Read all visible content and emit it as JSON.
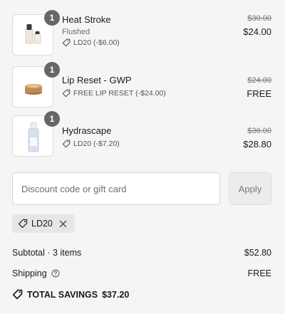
{
  "items": [
    {
      "quantity": "1",
      "name": "Heat Stroke",
      "variant": "Flushed",
      "discount": "LD20 (-$6.00)",
      "original_price": "$30.00",
      "price": "$24.00",
      "thumb_icon": "serum-bottle-icon"
    },
    {
      "quantity": "1",
      "name": "Lip Reset - GWP",
      "variant": "",
      "discount": "FREE LIP RESET (-$24.00)",
      "original_price": "$24.00",
      "price": "FREE",
      "thumb_icon": "lip-balm-jar-icon"
    },
    {
      "quantity": "1",
      "name": "Hydrascape",
      "variant": "",
      "discount": "LD20 (-$7.20)",
      "original_price": "$36.00",
      "price": "$28.80",
      "thumb_icon": "dropper-bottle-icon"
    }
  ],
  "discount_field": {
    "placeholder": "Discount code or gift card",
    "value": ""
  },
  "apply_label": "Apply",
  "applied_code": "LD20",
  "subtotal": {
    "label": "Subtotal · 3 items",
    "value": "$52.80"
  },
  "shipping": {
    "label": "Shipping",
    "value": "FREE"
  },
  "total_savings": {
    "label": "TOTAL SAVINGS",
    "value": "$37.20"
  },
  "colors": {
    "background": "#f5f5f5",
    "badge": "#666666",
    "apply_button_bg": "#ececec",
    "chip_bg": "#e6e6e6"
  }
}
